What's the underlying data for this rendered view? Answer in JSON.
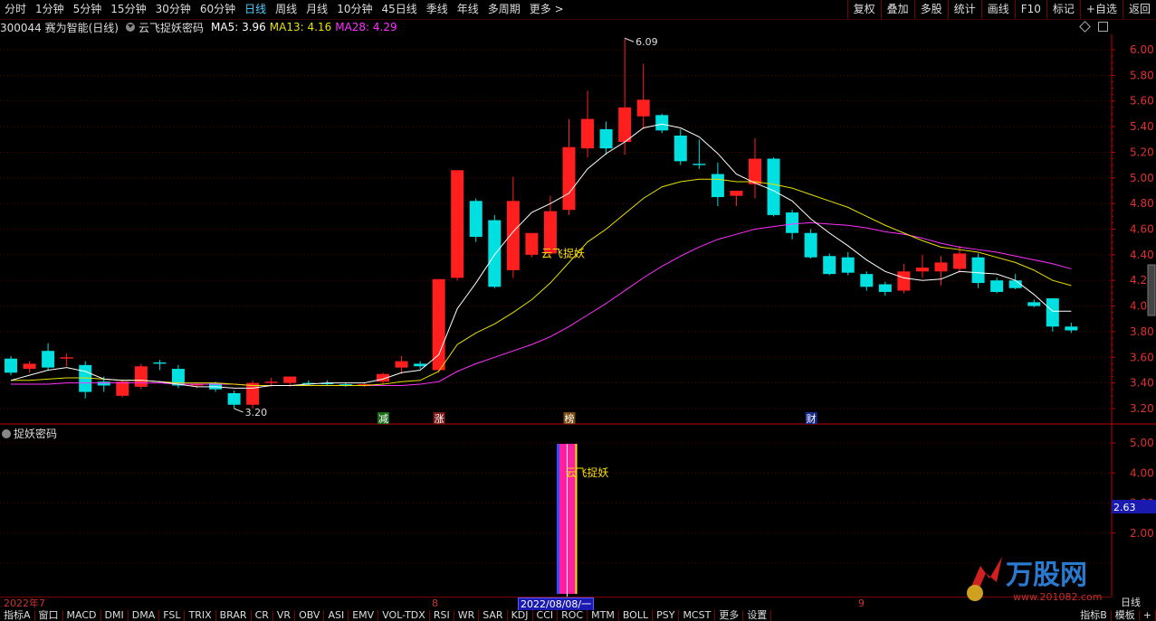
{
  "toolbar": {
    "periods": [
      "分时",
      "1分钟",
      "5分钟",
      "15分钟",
      "30分钟",
      "60分钟",
      "日线",
      "周线",
      "月线",
      "10分钟",
      "45日线",
      "季线",
      "年线",
      "多周期",
      "更多 >"
    ],
    "active_period": "日线",
    "right_buttons": [
      "复权",
      "叠加",
      "多股",
      "统计",
      "画线",
      "F10",
      "标记",
      "+自选",
      "返回"
    ]
  },
  "info": {
    "stock": "300044 赛为智能(日线)",
    "indicator_name": "云飞捉妖密码",
    "ma5_label": "MA5: 3.96",
    "ma13_label": "MA13: 4.16",
    "ma28_label": "MA28: 4.29"
  },
  "colors": {
    "up": "#ff1f1f",
    "down": "#00e0e0",
    "ma5": "#ffffff",
    "ma13": "#e8e000",
    "ma28": "#ff30ff",
    "grid": "#5a0000",
    "axis": "#c00000"
  },
  "main_chart": {
    "y_ticks": [
      "6.00",
      "5.80",
      "5.60",
      "5.40",
      "5.20",
      "5.00",
      "4.80",
      "4.60",
      "4.40",
      "4.20",
      "4.00",
      "3.80",
      "3.60",
      "3.40",
      "3.20"
    ],
    "high_label": "6.09",
    "low_label": "3.20",
    "signal_text": "云飞捉妖",
    "event_markers": [
      "减",
      "涨",
      "榜",
      "财"
    ]
  },
  "sub_chart": {
    "title": "捉妖密码",
    "y_ticks": [
      "5.00",
      "4.00",
      "3.00",
      "2.00"
    ],
    "current_value": "2.63",
    "signal_text": "云飞捉妖"
  },
  "date_axis": {
    "labels": [
      "2022年7",
      "8",
      "2022/08/08/一",
      "9"
    ],
    "right_label": "日线"
  },
  "bottom_tabs": [
    "指标A",
    "窗口",
    "MACD",
    "DMI",
    "DMA",
    "FSL",
    "TRIX",
    "BRAR",
    "CR",
    "VR",
    "OBV",
    "ASI",
    "EMV",
    "VOL-TDX",
    "RSI",
    "WR",
    "SAR",
    "KDJ",
    "CCI",
    "ROC",
    "MTM",
    "BOLL",
    "PSY",
    "MCST",
    "更多",
    "设置"
  ],
  "bottom_right": [
    "指标B",
    "模板",
    "+"
  ],
  "watermark": {
    "brand": "万股网",
    "url": "www.201082.com"
  },
  "chart_data": {
    "type": "candlestick",
    "ylim": [
      3.15,
      6.15
    ],
    "candles": [
      {
        "o": 3.59,
        "h": 3.61,
        "l": 3.46,
        "c": 3.48
      },
      {
        "o": 3.51,
        "h": 3.57,
        "l": 3.48,
        "c": 3.55
      },
      {
        "o": 3.65,
        "h": 3.71,
        "l": 3.5,
        "c": 3.52
      },
      {
        "o": 3.59,
        "h": 3.63,
        "l": 3.53,
        "c": 3.6
      },
      {
        "o": 3.54,
        "h": 3.57,
        "l": 3.28,
        "c": 3.33
      },
      {
        "o": 3.41,
        "h": 3.45,
        "l": 3.33,
        "c": 3.38
      },
      {
        "o": 3.3,
        "h": 3.42,
        "l": 3.29,
        "c": 3.41
      },
      {
        "o": 3.37,
        "h": 3.55,
        "l": 3.35,
        "c": 3.53
      },
      {
        "o": 3.56,
        "h": 3.58,
        "l": 3.5,
        "c": 3.55
      },
      {
        "o": 3.51,
        "h": 3.54,
        "l": 3.36,
        "c": 3.38
      },
      {
        "o": 3.38,
        "h": 3.4,
        "l": 3.36,
        "c": 3.39
      },
      {
        "o": 3.4,
        "h": 3.41,
        "l": 3.33,
        "c": 3.35
      },
      {
        "o": 3.32,
        "h": 3.34,
        "l": 3.2,
        "c": 3.23
      },
      {
        "o": 3.23,
        "h": 3.42,
        "l": 3.2,
        "c": 3.4
      },
      {
        "o": 3.4,
        "h": 3.44,
        "l": 3.37,
        "c": 3.41
      },
      {
        "o": 3.4,
        "h": 3.44,
        "l": 3.37,
        "c": 3.45
      },
      {
        "o": 3.4,
        "h": 3.42,
        "l": 3.38,
        "c": 3.39
      },
      {
        "o": 3.4,
        "h": 3.42,
        "l": 3.38,
        "c": 3.39
      },
      {
        "o": 3.39,
        "h": 3.4,
        "l": 3.37,
        "c": 3.38
      },
      {
        "o": 3.39,
        "h": 3.4,
        "l": 3.37,
        "c": 3.39
      },
      {
        "o": 3.41,
        "h": 3.48,
        "l": 3.39,
        "c": 3.47
      },
      {
        "o": 3.52,
        "h": 3.61,
        "l": 3.47,
        "c": 3.57
      },
      {
        "o": 3.55,
        "h": 3.57,
        "l": 3.51,
        "c": 3.53
      },
      {
        "o": 3.5,
        "h": 4.21,
        "l": 3.48,
        "c": 4.21
      },
      {
        "o": 4.22,
        "h": 5.06,
        "l": 4.2,
        "c": 5.06
      },
      {
        "o": 4.82,
        "h": 4.84,
        "l": 4.5,
        "c": 4.54
      },
      {
        "o": 4.67,
        "h": 4.71,
        "l": 4.14,
        "c": 4.15
      },
      {
        "o": 4.28,
        "h": 5.01,
        "l": 4.22,
        "c": 4.82
      },
      {
        "o": 4.4,
        "h": 4.56,
        "l": 4.38,
        "c": 4.57
      },
      {
        "o": 4.41,
        "h": 4.86,
        "l": 4.4,
        "c": 4.74
      },
      {
        "o": 4.75,
        "h": 5.46,
        "l": 4.71,
        "c": 5.24
      },
      {
        "o": 5.23,
        "h": 5.68,
        "l": 5.16,
        "c": 5.46
      },
      {
        "o": 5.38,
        "h": 5.44,
        "l": 5.18,
        "c": 5.23
      },
      {
        "o": 5.28,
        "h": 6.09,
        "l": 5.18,
        "c": 5.55
      },
      {
        "o": 5.48,
        "h": 5.89,
        "l": 5.38,
        "c": 5.61
      },
      {
        "o": 5.49,
        "h": 5.5,
        "l": 5.35,
        "c": 5.37
      },
      {
        "o": 5.33,
        "h": 5.38,
        "l": 5.1,
        "c": 5.13
      },
      {
        "o": 5.11,
        "h": 5.3,
        "l": 5.07,
        "c": 5.1
      },
      {
        "o": 5.03,
        "h": 5.12,
        "l": 4.78,
        "c": 4.85
      },
      {
        "o": 4.86,
        "h": 4.9,
        "l": 4.78,
        "c": 4.9
      },
      {
        "o": 4.95,
        "h": 5.31,
        "l": 4.84,
        "c": 5.15
      },
      {
        "o": 5.15,
        "h": 5.16,
        "l": 4.7,
        "c": 4.71
      },
      {
        "o": 4.73,
        "h": 4.75,
        "l": 4.52,
        "c": 4.57
      },
      {
        "o": 4.57,
        "h": 4.6,
        "l": 4.37,
        "c": 4.38
      },
      {
        "o": 4.39,
        "h": 4.41,
        "l": 4.24,
        "c": 4.25
      },
      {
        "o": 4.38,
        "h": 4.42,
        "l": 4.24,
        "c": 4.26
      },
      {
        "o": 4.25,
        "h": 4.27,
        "l": 4.12,
        "c": 4.15
      },
      {
        "o": 4.17,
        "h": 4.19,
        "l": 4.08,
        "c": 4.11
      },
      {
        "o": 4.12,
        "h": 4.33,
        "l": 4.1,
        "c": 4.27
      },
      {
        "o": 4.27,
        "h": 4.4,
        "l": 4.22,
        "c": 4.3
      },
      {
        "o": 4.27,
        "h": 4.39,
        "l": 4.16,
        "c": 4.34
      },
      {
        "o": 4.29,
        "h": 4.47,
        "l": 4.26,
        "c": 4.41
      },
      {
        "o": 4.38,
        "h": 4.41,
        "l": 4.14,
        "c": 4.18
      },
      {
        "o": 4.2,
        "h": 4.22,
        "l": 4.1,
        "c": 4.11
      },
      {
        "o": 4.2,
        "h": 4.25,
        "l": 4.13,
        "c": 4.14
      },
      {
        "o": 4.03,
        "h": 4.05,
        "l": 3.99,
        "c": 4.0
      },
      {
        "o": 4.06,
        "h": 4.06,
        "l": 3.8,
        "c": 3.84
      },
      {
        "o": 3.84,
        "h": 3.87,
        "l": 3.79,
        "c": 3.81
      }
    ],
    "ma5": [
      3.42,
      3.46,
      3.5,
      3.52,
      3.49,
      3.43,
      3.42,
      3.42,
      3.41,
      3.39,
      3.37,
      3.37,
      3.36,
      3.36,
      3.38,
      3.38,
      3.39,
      3.4,
      3.4,
      3.4,
      3.43,
      3.48,
      3.5,
      3.62,
      3.98,
      4.18,
      4.4,
      4.58,
      4.73,
      4.8,
      4.88,
      5.07,
      5.19,
      5.28,
      5.39,
      5.42,
      5.39,
      5.32,
      5.19,
      5.03,
      4.96,
      4.9,
      4.82,
      4.68,
      4.57,
      4.47,
      4.36,
      4.27,
      4.22,
      4.2,
      4.21,
      4.27,
      4.26,
      4.25,
      4.2,
      4.09,
      3.96,
      3.96
    ],
    "ma13": [
      3.42,
      3.42,
      3.43,
      3.44,
      3.44,
      3.43,
      3.42,
      3.42,
      3.41,
      3.4,
      3.4,
      3.4,
      3.39,
      3.38,
      3.38,
      3.38,
      3.38,
      3.38,
      3.38,
      3.38,
      3.39,
      3.41,
      3.42,
      3.49,
      3.7,
      3.79,
      3.86,
      3.95,
      4.05,
      4.18,
      4.34,
      4.5,
      4.6,
      4.72,
      4.84,
      4.93,
      4.97,
      4.99,
      4.99,
      4.97,
      4.97,
      4.95,
      4.92,
      4.87,
      4.82,
      4.77,
      4.7,
      4.63,
      4.57,
      4.51,
      4.46,
      4.44,
      4.42,
      4.38,
      4.34,
      4.28,
      4.2,
      4.16
    ],
    "ma28": [
      3.39,
      3.39,
      3.39,
      3.4,
      3.4,
      3.4,
      3.4,
      3.4,
      3.4,
      3.39,
      3.39,
      3.39,
      3.39,
      3.38,
      3.38,
      3.38,
      3.38,
      3.38,
      3.38,
      3.38,
      3.38,
      3.38,
      3.39,
      3.41,
      3.49,
      3.55,
      3.6,
      3.65,
      3.7,
      3.76,
      3.84,
      3.93,
      4.02,
      4.12,
      4.22,
      4.31,
      4.39,
      4.46,
      4.52,
      4.56,
      4.6,
      4.62,
      4.64,
      4.65,
      4.64,
      4.63,
      4.61,
      4.58,
      4.56,
      4.53,
      4.49,
      4.46,
      4.44,
      4.42,
      4.39,
      4.36,
      4.33,
      4.29
    ],
    "signal_index": 30
  }
}
